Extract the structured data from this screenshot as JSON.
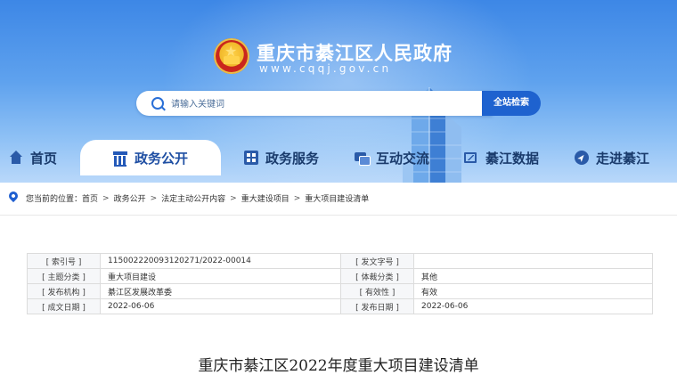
{
  "header": {
    "site_title": "重庆市綦江区人民政府",
    "site_domain": "www.cqqj.gov.cn",
    "search": {
      "placeholder": "请输入关键词",
      "button_label": "全站检索"
    }
  },
  "nav": {
    "items": [
      {
        "label": "首页",
        "icon": "home-icon",
        "active": false
      },
      {
        "label": "政务公开",
        "icon": "government-building-icon",
        "active": true
      },
      {
        "label": "政务服务",
        "icon": "services-grid-icon",
        "active": false
      },
      {
        "label": "互动交流",
        "icon": "chat-icon",
        "active": false
      },
      {
        "label": "綦江数据",
        "icon": "data-chart-icon",
        "active": false
      },
      {
        "label": "走进綦江",
        "icon": "compass-icon",
        "active": false
      }
    ]
  },
  "breadcrumb": {
    "prefix": "您当前的位置：",
    "items": [
      "首页",
      "政务公开",
      "法定主动公开内容",
      "重大建设项目",
      "重大项目建设清单"
    ],
    "separator": ">"
  },
  "info_table": {
    "rows": [
      [
        {
          "k": "[ 索引号 ]",
          "v": "115002220093120271/2022-00014"
        },
        {
          "k": "[ 发文字号 ]",
          "v": ""
        }
      ],
      [
        {
          "k": "[ 主题分类 ]",
          "v": "重大项目建设"
        },
        {
          "k": "[ 体裁分类 ]",
          "v": "其他"
        }
      ],
      [
        {
          "k": "[ 发布机构 ]",
          "v": "綦江区发展改革委"
        },
        {
          "k": "[ 有效性 ]",
          "v": "有效"
        }
      ],
      [
        {
          "k": "[ 成文日期 ]",
          "v": "2022-06-06"
        },
        {
          "k": "[ 发布日期 ]",
          "v": "2022-06-06"
        }
      ]
    ]
  },
  "document": {
    "title": "重庆市綦江区2022年度重大项目建设清单"
  },
  "colors": {
    "primary": "#1e62cf",
    "header_top": "#3d87e6",
    "header_bottom": "#b9d8fa",
    "nav_text": "#1a3b6c"
  }
}
